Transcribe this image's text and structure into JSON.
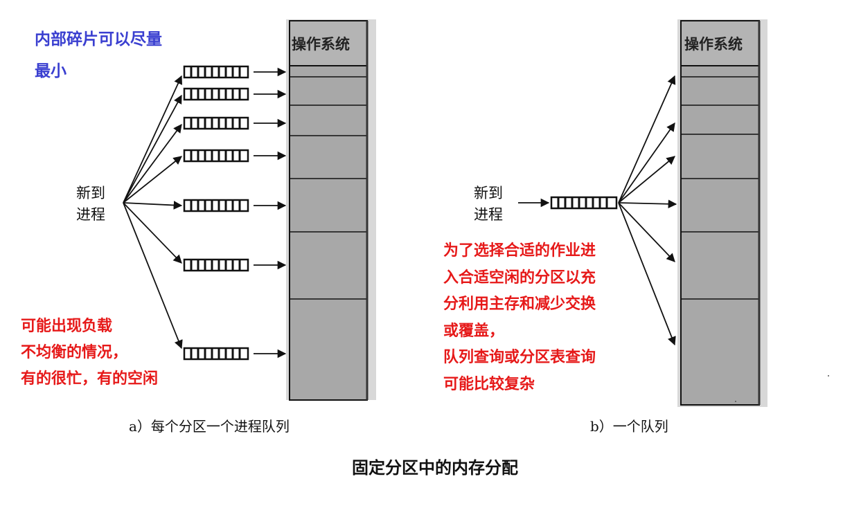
{
  "notes": {
    "internal_fragment": [
      "内部碎片可以尽量",
      "最小"
    ],
    "load_imbalance": [
      "可能出现负载",
      "不均衡的情况，",
      "有的很忙，有的空闲"
    ],
    "single_queue": [
      "为了选择合适的作业进",
      "入合适空闲的分区以充",
      "分利用主存和减少交换",
      "或覆盖，",
      "队列查询或分区表查询",
      "可能比较复杂"
    ]
  },
  "diagram_a": {
    "os_label": "操作系统",
    "new_process": [
      "新到",
      "进程"
    ],
    "caption": "a）每个分区一个进程队列"
  },
  "diagram_b": {
    "os_label": "操作系统",
    "new_process": [
      "新到",
      "进程"
    ],
    "caption": "b）一个队列"
  },
  "figure_title": "固定分区中的内存分配",
  "colors": {
    "memory_fill": "#a8a8a8",
    "os_fill": "#b4b4b4",
    "note_blue": "#3a3fd0",
    "note_red": "#e61919",
    "line": "#111111"
  }
}
